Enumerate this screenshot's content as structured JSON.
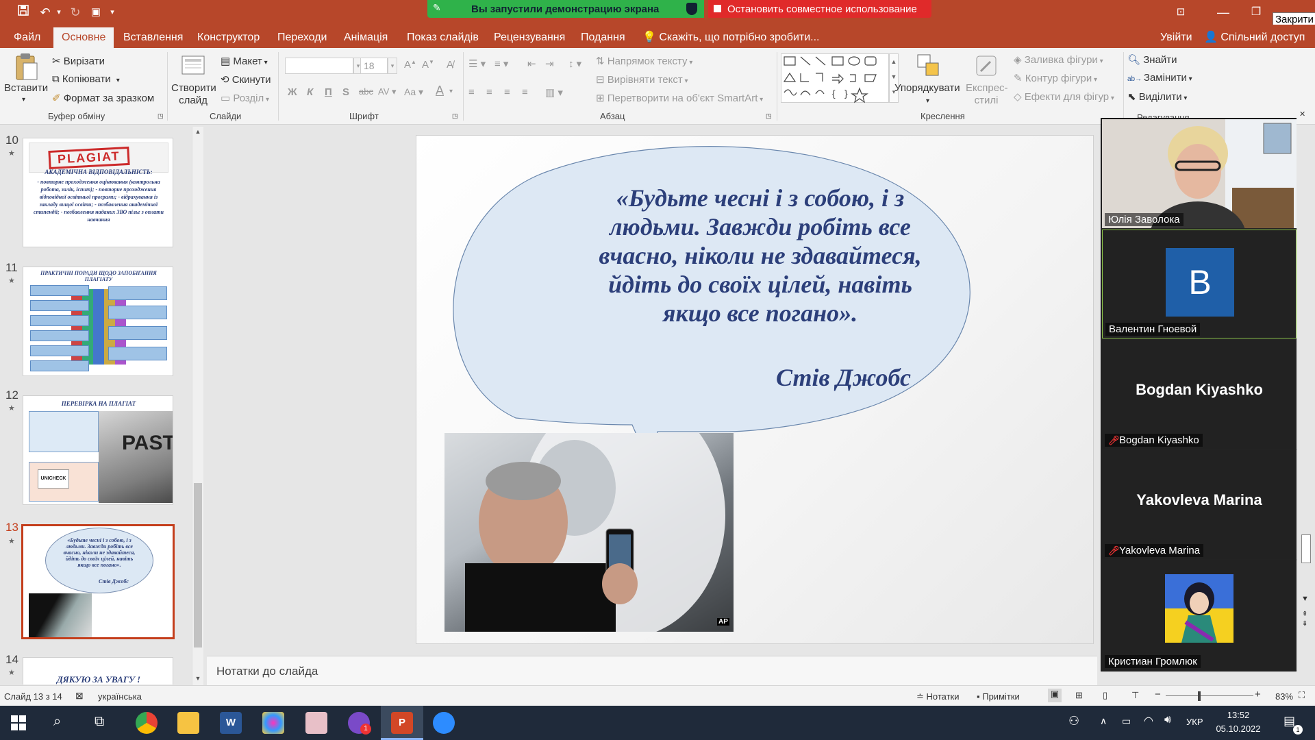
{
  "window": {
    "close_tooltip": "Закрити"
  },
  "share_banner": {
    "status_text": "Вы запустили демонстрацию экрана",
    "stop_text": "Остановить совместное использование"
  },
  "tabs": [
    "Файл",
    "Основне",
    "Вставлення",
    "Конструктор",
    "Переходи",
    "Анімація",
    "Показ слайдів",
    "Рецензування",
    "Подання"
  ],
  "tell_me": "Скажіть, що потрібно зробити...",
  "sign_in": "Увійти",
  "share": "Спільний доступ",
  "ribbon": {
    "paste": "Вставити",
    "cut": "Вирізати",
    "copy": "Копіювати",
    "format_painter": "Формат за зразком",
    "clipboard_group": "Буфер обміну",
    "new_slide": "Створити слайд",
    "layout": "Макет",
    "reset": "Скинути",
    "section": "Розділ",
    "slides_group": "Слайди",
    "font_size": "18",
    "font_group": "Шрифт",
    "text_direction": "Напрямок тексту",
    "align_text": "Вирівняти текст",
    "convert_smartart": "Перетворити на об'єкт SmartArt",
    "paragraph_group": "Абзац",
    "arrange": "Упорядкувати",
    "quick_styles": "Експрес-стилі",
    "shape_fill": "Заливка фігури",
    "shape_outline": "Контур фігури",
    "shape_effects": "Ефекти для фігур",
    "drawing_group": "Креслення",
    "find": "Знайти",
    "replace": "Замінити",
    "select": "Виділити",
    "editing_group": "Редагування"
  },
  "slides": [
    {
      "num": "10",
      "title": "PLAGIAT",
      "heading": "АКАДЕМІЧНА ВІДПОВІДАЛЬНІСТЬ:",
      "body": "- повторне проходження оцінювання (контрольна робота, залік, іспит); - повторне проходження відповідної освітньої програми; - відрахування із закладу вищої освіти; - позбавлення академічної стипендії; - позбавлення наданих ЗВО пільг з оплати навчання"
    },
    {
      "num": "11",
      "title": "ПРАКТИЧНІ ПОРАДИ ЩОДО ЗАПОБІГАННЯ ПЛАГІАТУ"
    },
    {
      "num": "12",
      "title": "ПЕРЕВІРКА НА ПЛАГІАТ",
      "tag": "UNICHECK",
      "banner": "PASTE"
    },
    {
      "num": "13",
      "quote": "«Будьте чесні і з собою, і з людьми. Завжди робіть все вчасно, ніколи не здавайтеся, йдіть до своїх цілей, навіть якщо все погано».",
      "author": "Стів Джобс"
    },
    {
      "num": "14",
      "title": "ДЯКУЮ ЗА УВАГУ !"
    }
  ],
  "main_slide": {
    "quote": "«Будьте чесні і з собою, і з людьми. Завжди робіть все вчасно, ніколи не здавайтеся, йдіть до своїх цілей, навіть якщо все погано».",
    "author": "Стів Джобс",
    "photo_badge": "AP"
  },
  "notes_placeholder": "Нотатки до слайда",
  "status": {
    "slide_info": "Слайд 13 з 14",
    "language": "українська",
    "notes_btn": "Нотатки",
    "comments_btn": "Примітки",
    "zoom": "83%"
  },
  "participants": [
    {
      "name": "Юлія Заволока",
      "has_video": true
    },
    {
      "name": "Валентин Гноевой",
      "avatar_letter": "B",
      "avatar_color": "#1f5fa8"
    },
    {
      "name": "Bogdan Kiyashko",
      "display": "Bogdan Kiyashko",
      "muted": true
    },
    {
      "name": "Yakovleva Marina",
      "display": "Yakovleva Marina",
      "muted": true
    },
    {
      "name": "Кристиан Громлюк",
      "has_avatar_image": true
    }
  ],
  "taskbar": {
    "lang": "УКР",
    "time": "13:52",
    "date": "05.10.2022",
    "notif_count": "1"
  }
}
